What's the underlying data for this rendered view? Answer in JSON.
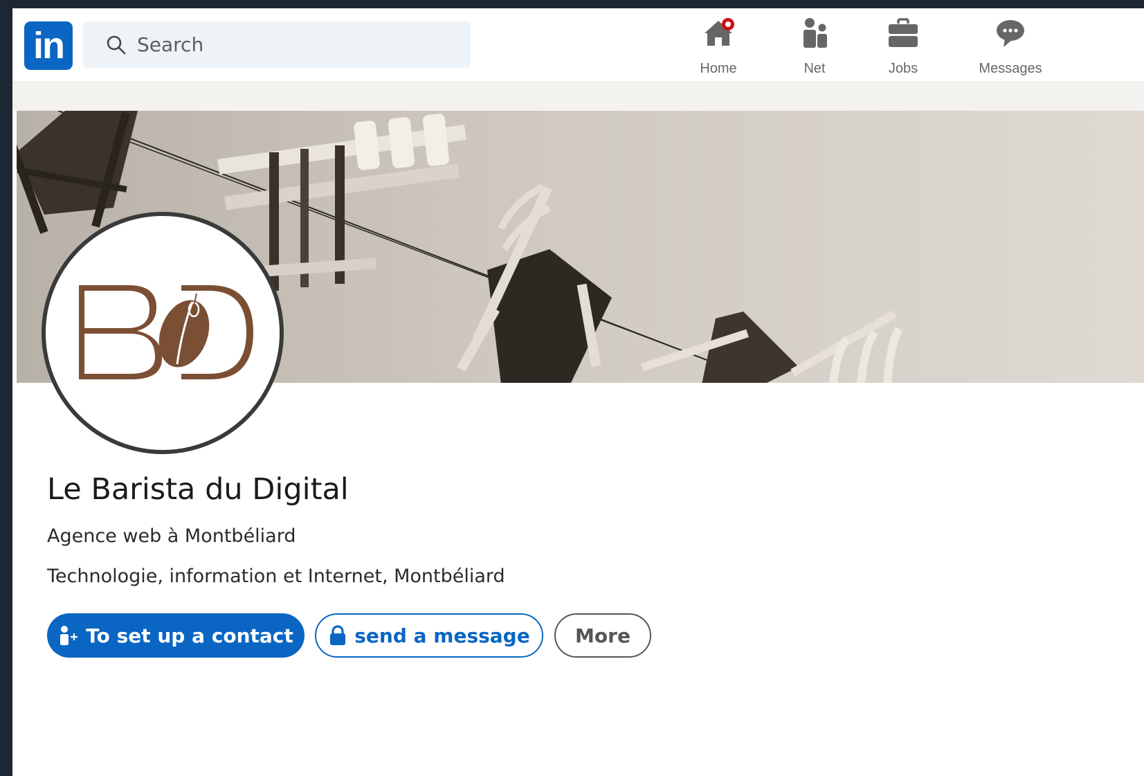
{
  "brand": {
    "logo_text": "in",
    "accent": "#0a66c2"
  },
  "search": {
    "placeholder": "Search",
    "icon": "search-icon"
  },
  "nav": {
    "items": [
      {
        "label": "Home",
        "icon": "home-icon",
        "badge_color": "#cc1016"
      },
      {
        "label": "Net",
        "icon": "people-icon"
      },
      {
        "label": "Jobs",
        "icon": "briefcase-icon"
      },
      {
        "label": "Messages",
        "icon": "chat-bubble-icon"
      }
    ]
  },
  "profile": {
    "logo_icon": "bd-logo-icon",
    "logo_color": "#7b4f34",
    "name": "Le Barista du Digital",
    "tagline": "Agence web à Montbéliard",
    "industry": "Technologie, information et Internet, Montbéliard"
  },
  "actions": {
    "connect_label": "To set up a contact",
    "connect_icon": "add-person-icon",
    "message_label": "send a message",
    "message_icon": "lock-icon",
    "more_label": "More"
  }
}
